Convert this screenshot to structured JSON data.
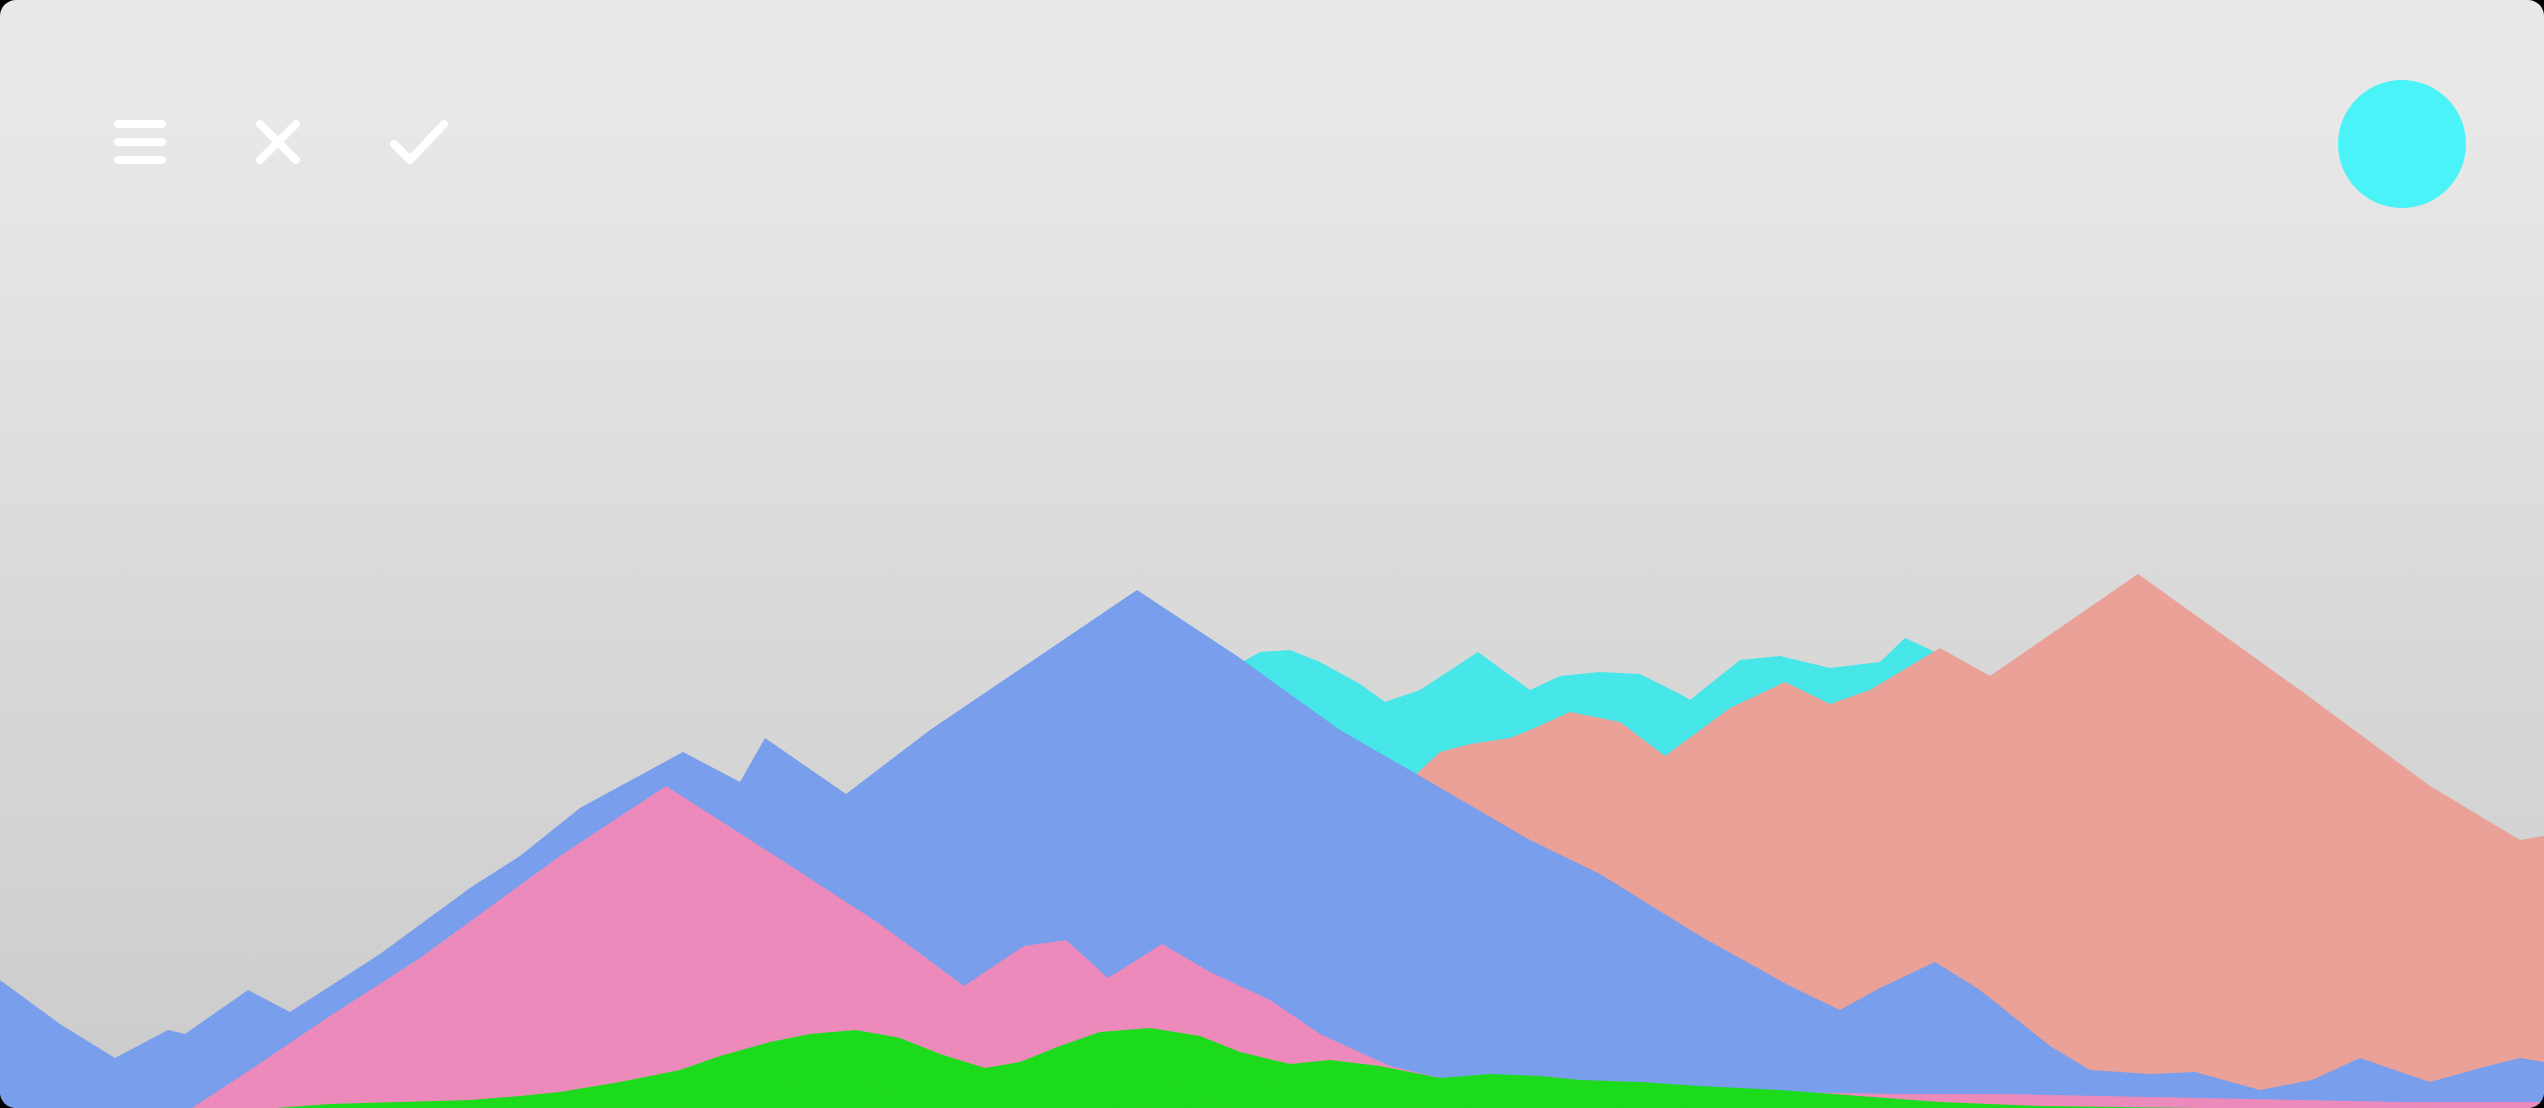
{
  "toolbar": {
    "icons": [
      "menu-icon",
      "close-icon",
      "check-icon"
    ],
    "icon_color": "#ffffff"
  },
  "action_circle": {
    "color": "#4af3f7"
  },
  "scene": {
    "background_top": "#e8e8e8",
    "background_bottom": "#cbcbcb",
    "layers": [
      {
        "name": "cyan-ridge",
        "color": "#4af0f2"
      },
      {
        "name": "salmon-mountains",
        "color": "#f4a89e"
      },
      {
        "name": "blue-mountains",
        "color": "#7ea5f6"
      },
      {
        "name": "pink-mountains",
        "color": "#f690c3"
      },
      {
        "name": "green-hills",
        "color": "#1fe41c"
      }
    ]
  }
}
